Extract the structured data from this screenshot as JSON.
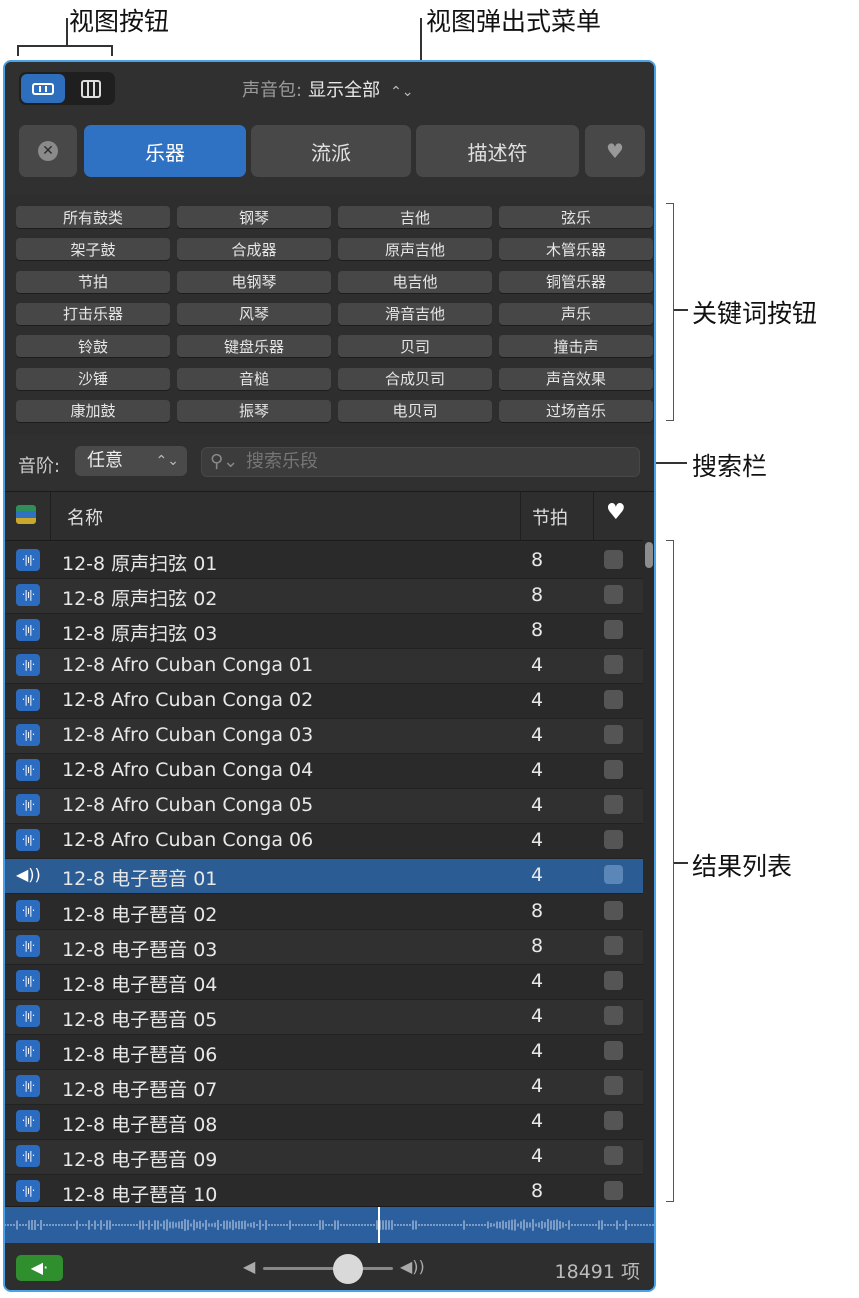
{
  "callouts": {
    "view_buttons": "视图按钮",
    "view_popup": "视图弹出式菜单",
    "keyword_buttons": "关键词按钮",
    "search_bar": "搜索栏",
    "results_list": "结果列表"
  },
  "header": {
    "sound_pack_label": "声音包:",
    "sound_pack_value": "显示全部",
    "tabs": [
      "乐器",
      "流派",
      "描述符"
    ]
  },
  "keywords": [
    "所有鼓类",
    "钢琴",
    "吉他",
    "弦乐",
    "架子鼓",
    "合成器",
    "原声吉他",
    "木管乐器",
    "节拍",
    "电钢琴",
    "电吉他",
    "铜管乐器",
    "打击乐器",
    "风琴",
    "滑音吉他",
    "声乐",
    "铃鼓",
    "键盘乐器",
    "贝司",
    "撞击声",
    "沙锤",
    "音槌",
    "合成贝司",
    "声音效果",
    "康加鼓",
    "振琴",
    "电贝司",
    "过场音乐"
  ],
  "filter": {
    "scale_label": "音阶:",
    "scale_value": "任意",
    "search_placeholder": "搜索乐段"
  },
  "list": {
    "col_name": "名称",
    "col_beats": "节拍",
    "rows": [
      {
        "name": "12-8 原声扫弦 01",
        "beats": "8"
      },
      {
        "name": "12-8 原声扫弦 02",
        "beats": "8"
      },
      {
        "name": "12-8 原声扫弦 03",
        "beats": "8"
      },
      {
        "name": "12-8 Afro Cuban Conga 01",
        "beats": "4"
      },
      {
        "name": "12-8 Afro Cuban Conga 02",
        "beats": "4"
      },
      {
        "name": "12-8 Afro Cuban Conga 03",
        "beats": "4"
      },
      {
        "name": "12-8 Afro Cuban Conga 04",
        "beats": "4"
      },
      {
        "name": "12-8 Afro Cuban Conga 05",
        "beats": "4"
      },
      {
        "name": "12-8 Afro Cuban Conga 06",
        "beats": "4"
      },
      {
        "name": "12-8 电子琶音 01",
        "beats": "4",
        "selected": true
      },
      {
        "name": "12-8 电子琶音 02",
        "beats": "8"
      },
      {
        "name": "12-8 电子琶音 03",
        "beats": "8"
      },
      {
        "name": "12-8 电子琶音 04",
        "beats": "4"
      },
      {
        "name": "12-8 电子琶音 05",
        "beats": "4"
      },
      {
        "name": "12-8 电子琶音 06",
        "beats": "4"
      },
      {
        "name": "12-8 电子琶音 07",
        "beats": "4"
      },
      {
        "name": "12-8 电子琶音 08",
        "beats": "4"
      },
      {
        "name": "12-8 电子琶音 09",
        "beats": "4"
      },
      {
        "name": "12-8 电子琶音 10",
        "beats": "8"
      }
    ]
  },
  "footer": {
    "volume": 0.65,
    "count": "18491 项"
  },
  "colors": {
    "accent": "#2f72c4",
    "selected_row": "#2b5d94",
    "play_green": "#2f8f2f",
    "waveform_bg": "#2c5f9e"
  }
}
